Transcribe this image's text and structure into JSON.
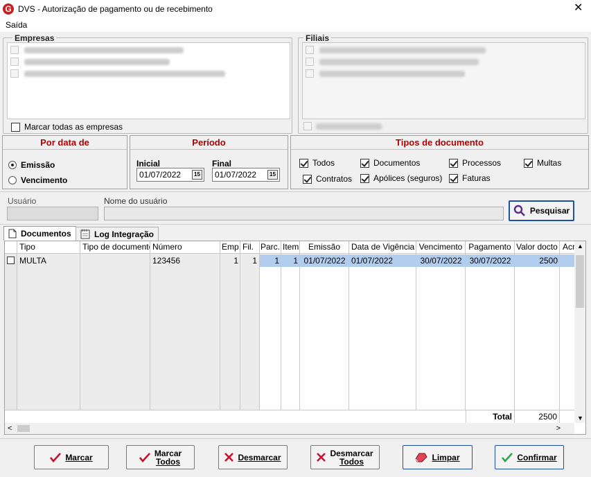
{
  "window": {
    "title": "DVS - Autorização de pagamento ou de recebimento",
    "logo_letter": "G"
  },
  "menu": {
    "items": [
      {
        "label": "Saída"
      }
    ]
  },
  "empresas": {
    "legend": "Empresas",
    "mark_all_label": "Marcar todas as empresas",
    "mark_all_checked": false
  },
  "filiais": {
    "legend": "Filiais"
  },
  "por_data": {
    "title": "Por data de",
    "options": [
      {
        "label": "Emissão",
        "selected": true
      },
      {
        "label": "Vencimento",
        "selected": false
      }
    ]
  },
  "periodo": {
    "title": "Período",
    "inicial_label": "Inicial",
    "inicial_value": "01/07/2022",
    "final_label": "Final",
    "final_value": "01/07/2022",
    "calendar_glyph": "15"
  },
  "tipos": {
    "title": "Tipos de documento",
    "items": [
      {
        "label": "Todos",
        "checked": true
      },
      {
        "label": "Documentos",
        "checked": true
      },
      {
        "label": "Processos",
        "checked": true
      },
      {
        "label": "Multas",
        "checked": true
      },
      {
        "label": "Contratos",
        "checked": true
      },
      {
        "label": "Apólices (seguros)",
        "checked": true
      },
      {
        "label": "Faturas",
        "checked": true
      }
    ]
  },
  "usuario": {
    "label": "Usuário",
    "nome_label": "Nome do usuário",
    "value": "",
    "nome_value": ""
  },
  "search_button": {
    "label": "Pesquisar"
  },
  "tabs": [
    {
      "label": "Documentos",
      "active": true
    },
    {
      "label": "Log Integração",
      "active": false
    }
  ],
  "grid": {
    "columns": [
      "Tipo",
      "Tipo de documento",
      "Número",
      "Emp.",
      "Fil.",
      "Parc.",
      "Item",
      "Emissão",
      "Data de Vigência",
      "Vencimento",
      "Pagamento",
      "Valor docto",
      "Acr"
    ],
    "rows": [
      {
        "checked": false,
        "tipo": "MULTA",
        "tipo_documento": "",
        "numero": "123456",
        "emp": "1",
        "fil": "1",
        "parc": "1",
        "item": "1",
        "emissao": "01/07/2022",
        "vigencia": "01/07/2022",
        "vencimento": "30/07/2022",
        "pagamento": "30/07/2022",
        "valor": "2500"
      }
    ],
    "footer": {
      "total_label": "Total",
      "total_value": "2500"
    },
    "selection_color": "#b3cdee"
  },
  "buttons": {
    "marcar": "Marcar",
    "marcar_todos_1": "Marcar",
    "marcar_todos_2": "Todos",
    "desmarcar": "Desmarcar",
    "desmarcar_todos_1": "Desmarcar",
    "desmarcar_todos_2": "Todos",
    "limpar": "Limpar",
    "confirmar": "Confirmar"
  },
  "colors": {
    "accent_red": "#b00000",
    "check_green": "#2aa84a",
    "x_red": "#c8102e",
    "focus_blue": "#1d4fa8"
  }
}
